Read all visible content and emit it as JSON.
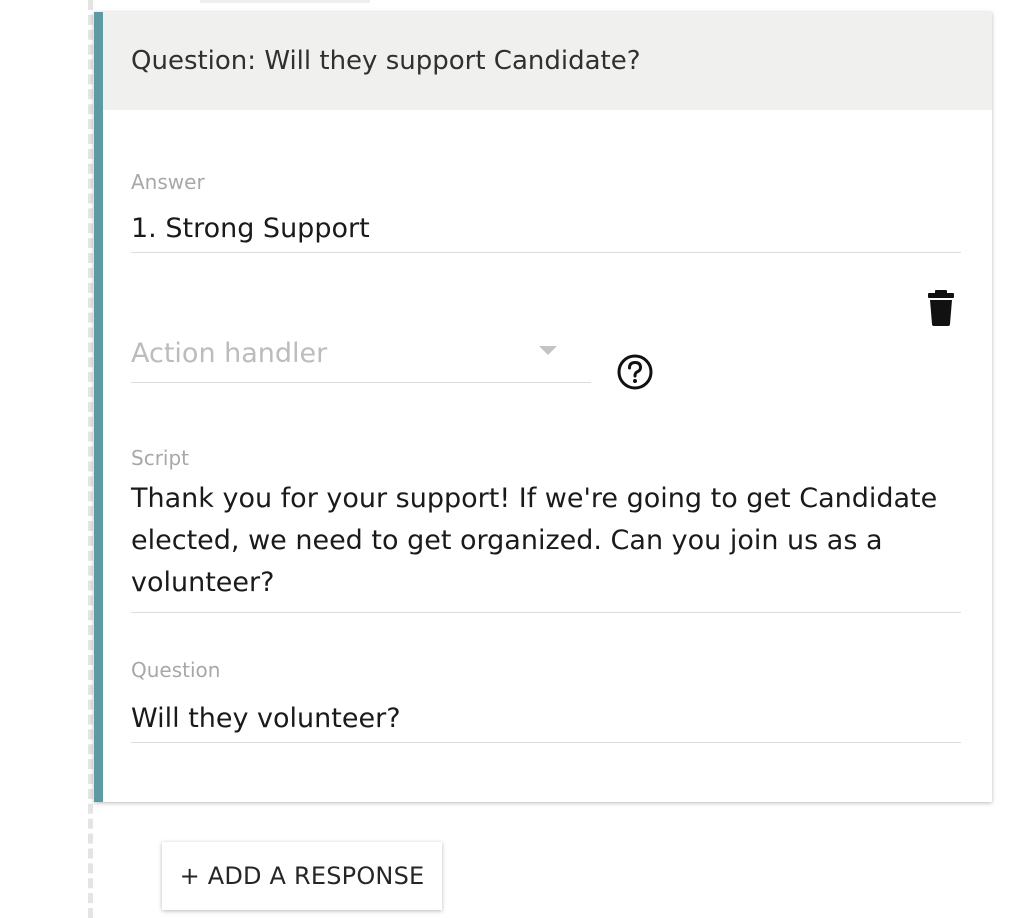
{
  "card": {
    "header_title": "Question: Will they support Candidate?",
    "answer": {
      "label": "Answer",
      "value": "1. Strong Support"
    },
    "action_handler": {
      "placeholder": "Action handler"
    },
    "script": {
      "label": "Script",
      "value": "Thank you for your support! If we're going to get Candidate elected, we need to get organized. Can you join us as a volunteer?"
    },
    "question": {
      "label": "Question",
      "value": "Will they volunteer?"
    },
    "icons": {
      "delete": "trash-icon",
      "help": "help-circle-icon"
    }
  },
  "add_response_button": {
    "label": "+ ADD A RESPONSE"
  },
  "colors": {
    "accent_border": "#5e9aa2",
    "header_bg": "#f0f1ef",
    "label_gray": "#a8a8a8",
    "placeholder_gray": "#bcbcbc"
  }
}
